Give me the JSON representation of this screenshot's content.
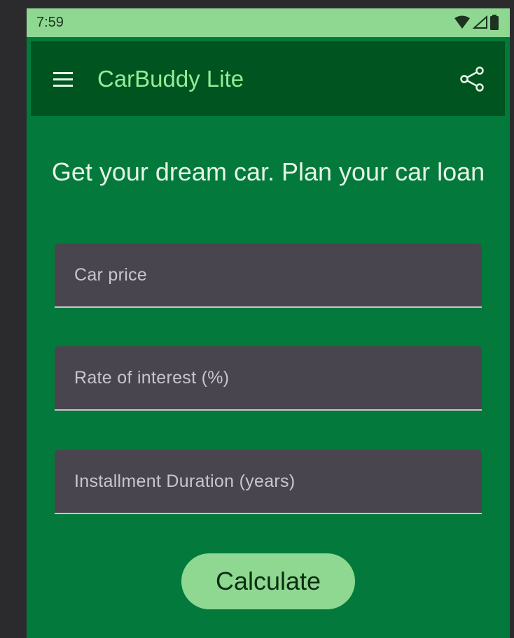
{
  "status_bar": {
    "time": "7:59",
    "icons": [
      "wifi-icon",
      "signal-icon",
      "battery-icon"
    ]
  },
  "app_bar": {
    "title": "CarBuddy Lite",
    "menu_icon": "menu-icon",
    "share_icon": "share-icon"
  },
  "main": {
    "headline": "Get your dream car. Plan your car loan",
    "fields": {
      "car_price": {
        "placeholder": "Car price",
        "value": ""
      },
      "interest_rate": {
        "placeholder": "Rate of interest (%)",
        "value": ""
      },
      "duration": {
        "placeholder": "Installment Duration (years)",
        "value": ""
      }
    },
    "calculate_label": "Calculate"
  },
  "colors": {
    "status_bar": "#8fd891",
    "app_bar": "#005420",
    "background": "#037a3c",
    "title": "#95ec97",
    "field_bg": "#49454f",
    "button": "#8fd891"
  }
}
